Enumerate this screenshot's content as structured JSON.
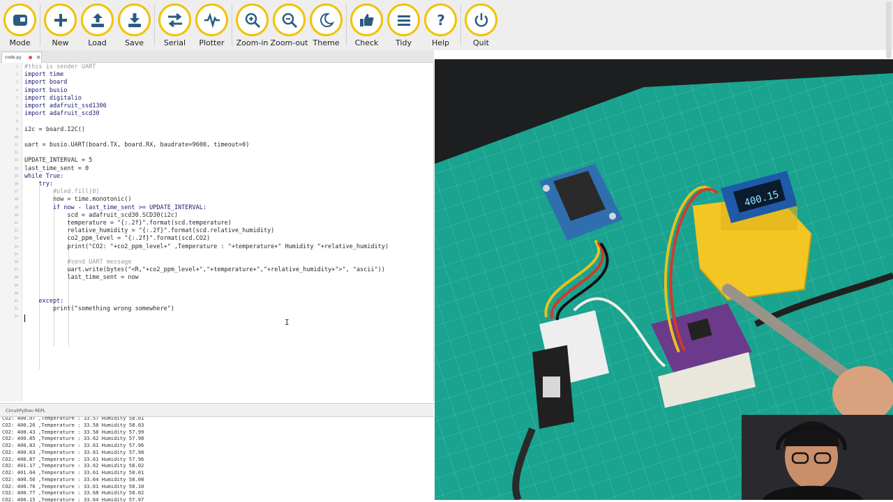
{
  "toolbar": {
    "buttons": [
      {
        "label": "Mode",
        "icon": "mode-icon"
      },
      {
        "label": "New",
        "icon": "plus-icon"
      },
      {
        "label": "Load",
        "icon": "upload-icon"
      },
      {
        "label": "Save",
        "icon": "download-icon"
      },
      {
        "label": "Serial",
        "icon": "swap-arrows-icon"
      },
      {
        "label": "Plotter",
        "icon": "waveform-icon"
      },
      {
        "label": "Zoom-in",
        "icon": "zoom-in-icon"
      },
      {
        "label": "Zoom-out",
        "icon": "zoom-out-icon"
      },
      {
        "label": "Theme",
        "icon": "moon-icon"
      },
      {
        "label": "Check",
        "icon": "thumbs-up-icon"
      },
      {
        "label": "Tidy",
        "icon": "lines-icon"
      },
      {
        "label": "Help",
        "icon": "question-icon"
      },
      {
        "label": "Quit",
        "icon": "power-icon"
      }
    ],
    "accent_color": "#f2c200"
  },
  "tab": {
    "filename": "code.py"
  },
  "editor": {
    "line_numbers": [
      "1",
      "2",
      "3",
      "4",
      "5",
      "6",
      "7",
      "8",
      "9",
      "10",
      "11",
      "12",
      "13",
      "14",
      "15",
      "16",
      "17",
      "18",
      "19",
      "20",
      "21",
      "22",
      "23",
      "24",
      "25",
      "26",
      "27",
      "28",
      "29",
      "30",
      "31",
      "32",
      "33"
    ],
    "lines": [
      "#this is sender UART",
      "import time",
      "import board",
      "import busio",
      "import digitalio",
      "import adafruit_ssd1306",
      "import adafruit_scd30",
      "",
      "i2c = board.I2C()",
      "",
      "uart = busio.UART(board.TX, board.RX, baudrate=9600, timeout=0)",
      "",
      "UPDATE_INTERVAL = 5",
      "last_time_sent = 0",
      "while True:",
      "    try:",
      "        #oled.fill(0)",
      "        now = time.monotonic()",
      "        if now - last_time_sent >= UPDATE_INTERVAL:",
      "            scd = adafruit_scd30.SCD30(i2c)",
      "            temperature = \"{:.2f}\".format(scd.temperature)",
      "            relative_humidity = \"{:.2f}\".format(scd.relative_humidity)",
      "            co2_ppm_level = \"{:.2f}\".format(scd.CO2)",
      "            print(\"CO2: \"+co2_ppm_level+\" ,Temperature : \"+temperature+\" Humidity \"+relative_humidity)",
      "",
      "            #send UART message",
      "            uart.write(bytes(\"<R,\"+co2_ppm_level+\",\"+temperature+\",\"+relative_humidity+\">\", \"ascii\"))",
      "            last_time_sent = now",
      "",
      "",
      "    except:",
      "        print(\"something wrong somewhere\")",
      ""
    ]
  },
  "repl": {
    "title": "CircuitPython REPL",
    "lines": [
      "CO2: 400.07 ,Temperature : 33.57 Humidity 58.01",
      "CO2: 400.26 ,Temperature : 33.58 Humidity 58.03",
      "CO2: 400.43 ,Temperature : 33.58 Humidity 57.99",
      "CO2: 400.85 ,Temperature : 33.62 Humidity 57.98",
      "CO2: 400.83 ,Temperature : 33.61 Humidity 57.96",
      "CO2: 400.63 ,Temperature : 33.61 Humidity 57.98",
      "CO2: 400.87 ,Temperature : 33.61 Humidity 57.96",
      "CO2: 401.17 ,Temperature : 33.62 Humidity 58.02",
      "CO2: 401.04 ,Temperature : 33.61 Humidity 58.01",
      "CO2: 400.56 ,Temperature : 33.64 Humidity 58.08",
      "CO2: 400.76 ,Temperature : 33.61 Humidity 58.10",
      "CO2: 400.77 ,Temperature : 33.68 Humidity 58.02",
      "CO2: 400.15 ,Temperature : 33.64 Humidity 57.97"
    ]
  },
  "video": {
    "oled_reading": "400.15"
  }
}
